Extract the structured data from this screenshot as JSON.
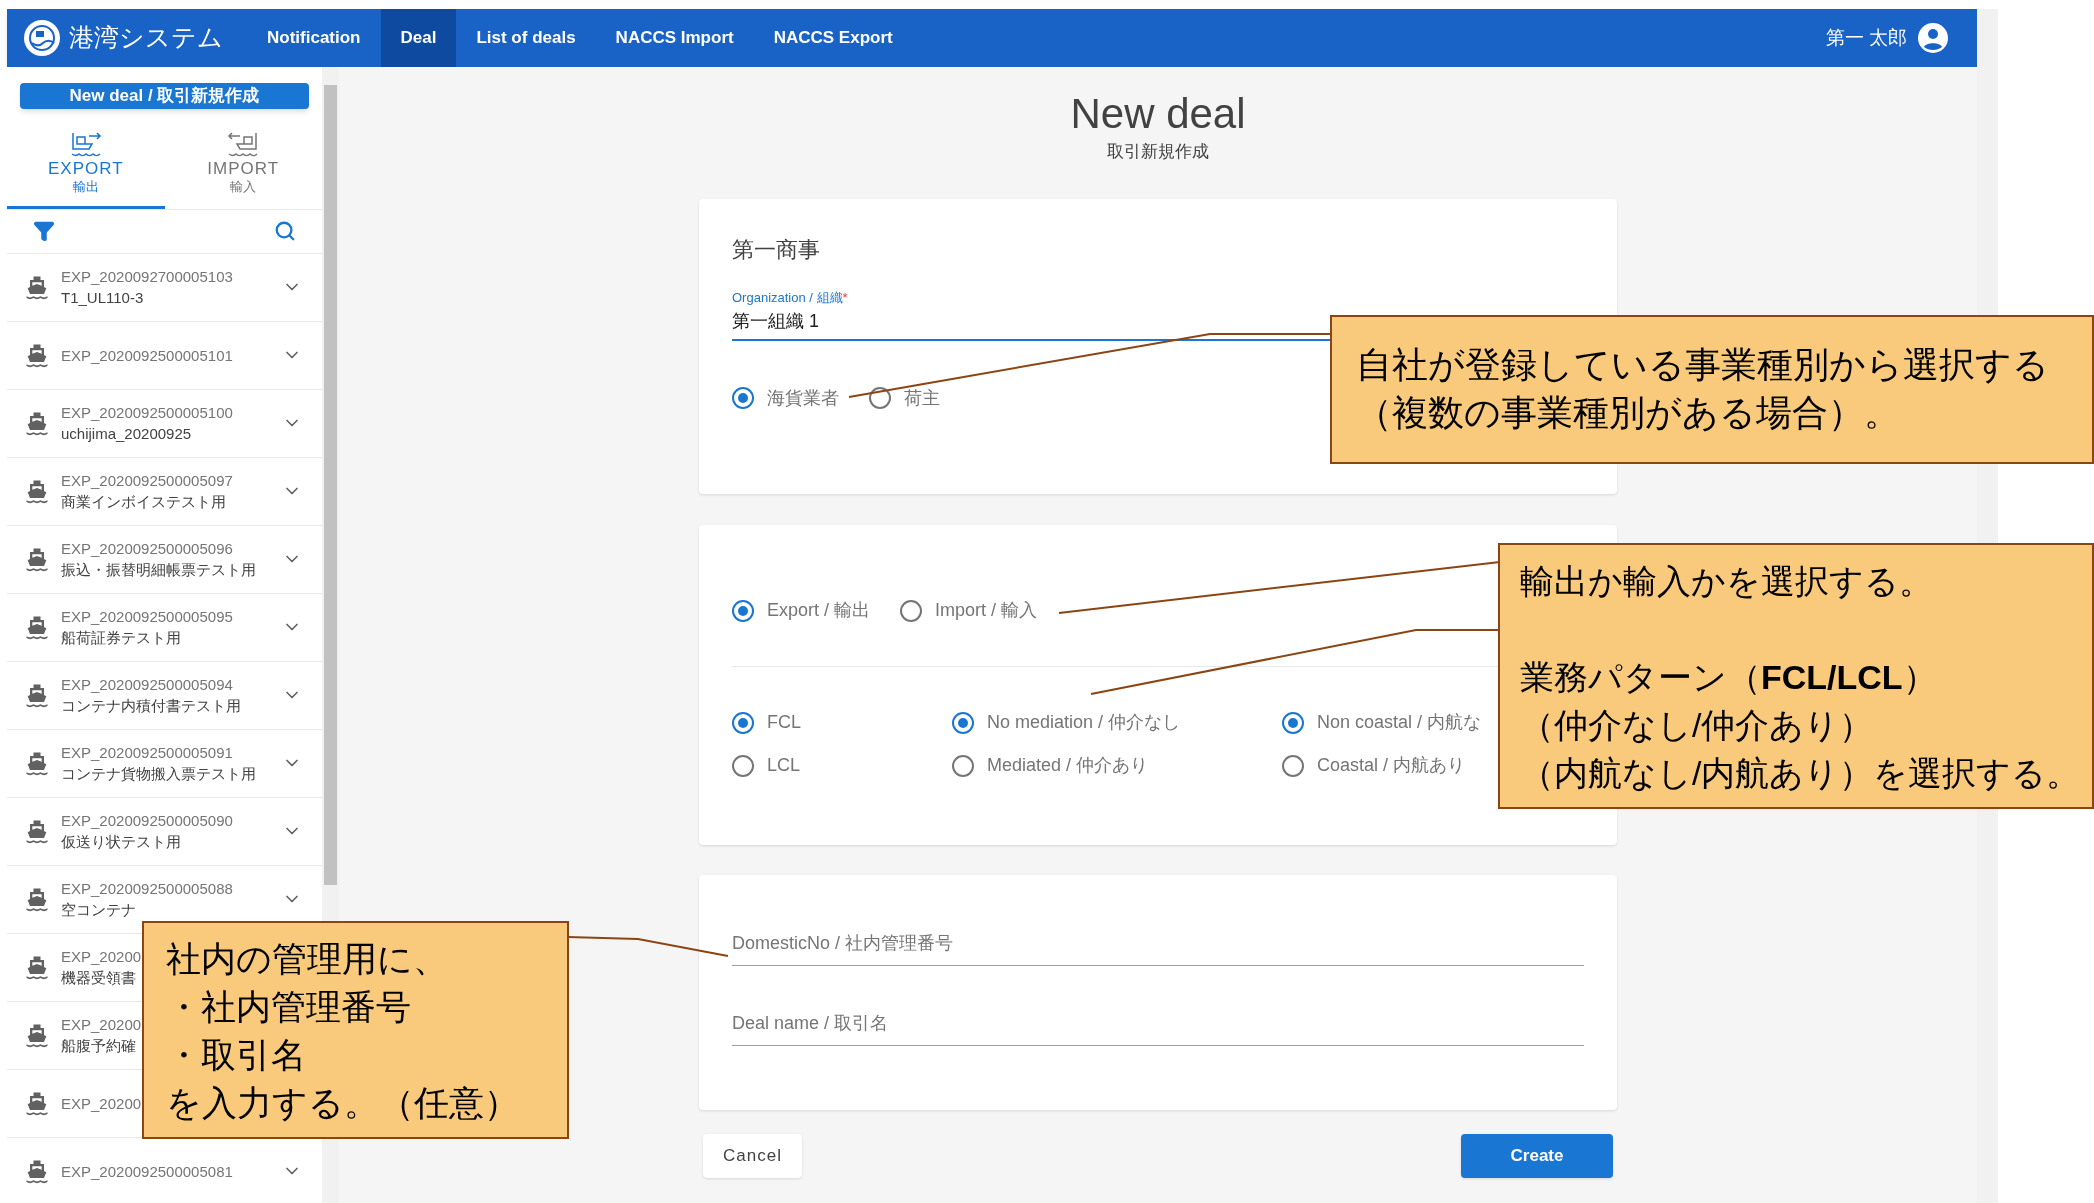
{
  "header": {
    "app_name": "港湾システム",
    "nav": [
      {
        "label": "Notification",
        "selected": false
      },
      {
        "label": "Deal",
        "selected": true
      },
      {
        "label": "List of deals",
        "selected": false
      },
      {
        "label": "NACCS Import",
        "selected": false
      },
      {
        "label": "NACCS Export",
        "selected": false
      }
    ],
    "user": "第一 太郎"
  },
  "sidebar": {
    "new_button": "New deal / 取引新規作成",
    "tabs": [
      {
        "label": "EXPORT",
        "sublabel": "輸出",
        "kind": "export",
        "selected": true
      },
      {
        "label": "IMPORT",
        "sublabel": "輸入",
        "kind": "import",
        "selected": false
      }
    ],
    "items": [
      {
        "id": "EXP_2020092700005103",
        "title": "T1_UL110-3",
        "expandable": true
      },
      {
        "id": "EXP_2020092500005101",
        "expandable": true
      },
      {
        "id": "EXP_2020092500005100",
        "title": "uchijima_20200925",
        "expandable": true
      },
      {
        "id": "EXP_2020092500005097",
        "title": "商業インボイステスト用",
        "expandable": true
      },
      {
        "id": "EXP_2020092500005096",
        "title": "振込・振替明細帳票テスト用",
        "expandable": true
      },
      {
        "id": "EXP_2020092500005095",
        "title": "船荷証券テスト用",
        "expandable": true
      },
      {
        "id": "EXP_2020092500005094",
        "title": "コンテナ内積付書テスト用",
        "expandable": true
      },
      {
        "id": "EXP_2020092500005091",
        "title": "コンテナ貨物搬入票テスト用",
        "expandable": true
      },
      {
        "id": "EXP_2020092500005090",
        "title": "仮送り状テスト用",
        "expandable": true
      },
      {
        "id": "EXP_2020092500005088",
        "title": "空コンテナ",
        "expandable": true
      },
      {
        "id": "EXP_20200",
        "title": "機器受領書"
      },
      {
        "id": "EXP_20200",
        "title": "船腹予約確"
      },
      {
        "id": "EXP_20200"
      },
      {
        "id": "EXP_2020092500005081",
        "expandable": true
      }
    ]
  },
  "page": {
    "title": "New deal",
    "subtitle": "取引新規作成"
  },
  "company_card": {
    "company": "第一商事",
    "organization": {
      "label": "Organization / 組織",
      "required_mark": "*",
      "value": "第一組織 1"
    },
    "roles": [
      {
        "label": "海貨業者",
        "selected": true
      },
      {
        "label": "荷主",
        "selected": false
      }
    ]
  },
  "type_card": {
    "direction": [
      {
        "label": "Export / 輸出",
        "selected": true
      },
      {
        "label": "Import / 輸入",
        "selected": false
      }
    ],
    "option_groups": [
      [
        {
          "label": "FCL",
          "selected": true
        },
        {
          "label": "LCL",
          "selected": false
        }
      ],
      [
        {
          "label": "No mediation / 仲介なし",
          "selected": true
        },
        {
          "label": "Mediated / 仲介あり",
          "selected": false
        }
      ],
      [
        {
          "label": "Non coastal / 内航な",
          "selected": true
        },
        {
          "label": "Coastal / 内航あり",
          "selected": false
        }
      ]
    ]
  },
  "info_card": {
    "fields": [
      {
        "placeholder": "DomesticNo / 社内管理番号"
      },
      {
        "placeholder": "Deal name / 取引名"
      }
    ]
  },
  "buttons": {
    "cancel": "Cancel",
    "create": "Create"
  },
  "callouts": [
    {
      "paragraphs": [
        [
          "自社が登録している事業種別から選択する",
          "（複数の事業種別がある場合）。"
        ]
      ]
    },
    {
      "paragraphs": [
        [
          "輸出か輸入かを選択する。"
        ],
        [
          "業務パターン（**FCL/LCL**）",
          "（仲介なし/仲介あり）",
          "（内航なし/内航あり）を選択する。"
        ]
      ]
    },
    {
      "paragraphs": [
        [
          "社内の管理用に、",
          "・社内管理番号",
          "・取引名",
          "を入力する。（任意）"
        ]
      ]
    }
  ]
}
